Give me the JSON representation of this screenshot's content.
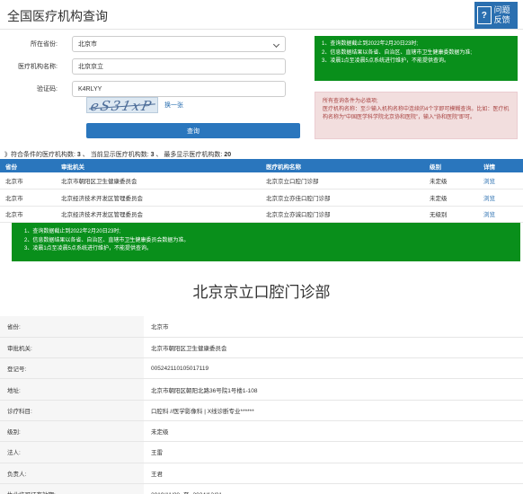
{
  "page": {
    "title": "全国医疗机构查询"
  },
  "feedback": {
    "icon_glyph": "?",
    "label_line1": "问题",
    "label_line2": "反馈"
  },
  "form": {
    "province_label": "所在省份:",
    "province_value": "北京市",
    "org_name_label": "医疗机构名称:",
    "org_name_value": "北京京立",
    "captcha_label": "验证码:",
    "captcha_value": "K4RLYY",
    "captcha_image_text": "eS31xP",
    "refresh_link": "换一张",
    "query_button": "查询"
  },
  "notice_green": [
    "1、查询数据截止到2022年2月20日23时;",
    "2、信息数据结果以各省、自治区、直辖市卫生健康委数据为准;",
    "3、凌晨1点至凌晨5点系统进行维护，不能提供查询。"
  ],
  "notice_pink": {
    "line1": "所有查询条件为必填项;",
    "line2": "医疗机构名称：至少输入机构名称中连续的4个字即可模糊查询。比如：医疗机构名称为“中国医学科学院北京协和医院”，输入“协和医院”即可。"
  },
  "summary": {
    "prefix": "》符合条件的医疗机构数:",
    "matched": "3",
    "current_label": "、 当前显示医疗机构数:",
    "current": "3",
    "max_label": "、 最多显示医疗机构数:",
    "max": "20"
  },
  "results": {
    "headers": [
      "省份",
      "审批机关",
      "医疗机构名称",
      "级别",
      "详情"
    ],
    "rows": [
      [
        "北京市",
        "北京市朝阳区卫生健康委员会",
        "北京京立口腔门诊部",
        "未定级",
        "浏览"
      ],
      [
        "北京市",
        "北京经济技术开发区管理委员会",
        "北京京立亦佳口腔门诊部",
        "未定级",
        "浏览"
      ],
      [
        "北京市",
        "北京经济技术开发区管理委员会",
        "北京京立亦诚口腔门诊部",
        "无级别",
        "浏览"
      ]
    ]
  },
  "banner": [
    "1、查询数据截止到2022年2月20日23时;",
    "2、信息数据结果以各省、自治区、直辖市卫生健康委员会数据为准。",
    "3、凌晨1点至凌晨5点系统进行维护，不能提供查询。"
  ],
  "detail": {
    "name": "北京京立口腔门诊部",
    "rows": [
      {
        "k": "省份:",
        "v": "北京市"
      },
      {
        "k": "审批机关:",
        "v": "北京市朝阳区卫生健康委员会"
      },
      {
        "k": "登记号:",
        "v": "005242110105017119"
      },
      {
        "k": "地址:",
        "v": "北京市朝阳区朝阳北路36号院1号楼1-108"
      },
      {
        "k": "诊疗科目:",
        "v": "口腔科 //医学影像科 | X线诊断专业******"
      },
      {
        "k": "级别:",
        "v": "未定级"
      },
      {
        "k": "法人:",
        "v": "王雷"
      },
      {
        "k": "负责人:",
        "v": "王君"
      },
      {
        "k": "执业许可证有效期:",
        "v": "2019/11/28 -至- 2024/12/31"
      }
    ]
  },
  "colors": {
    "primary": "#2a76bd",
    "notice_green": "#098f1b",
    "notice_pink": "#f2dede",
    "link": "#2a6fb0"
  }
}
